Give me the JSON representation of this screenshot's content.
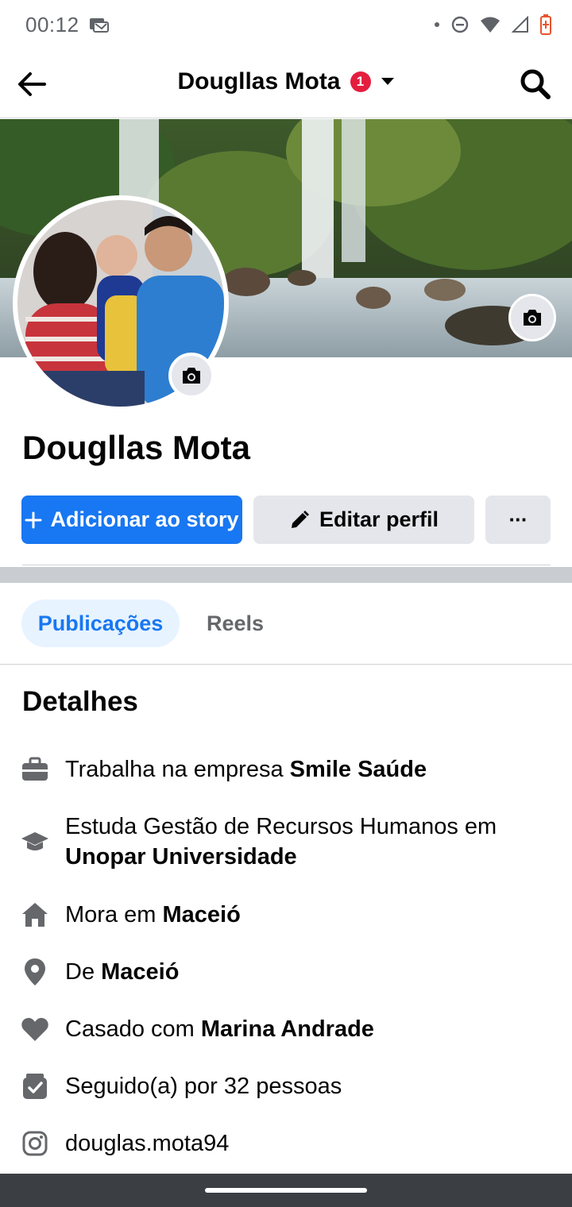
{
  "status_bar": {
    "time": "00:12"
  },
  "header": {
    "title": "Dougllas Mota",
    "badge": "1"
  },
  "profile": {
    "name": "Dougllas Mota"
  },
  "actions": {
    "add_story": "Adicionar ao story",
    "edit_profile": "Editar perfil",
    "more": "···"
  },
  "tabs": [
    {
      "label": "Publicações",
      "active": true
    },
    {
      "label": "Reels",
      "active": false
    }
  ],
  "details": {
    "title": "Detalhes",
    "items": [
      {
        "icon": "briefcase-icon",
        "prefix": "Trabalha na empresa ",
        "bold": "Smile Saúde"
      },
      {
        "icon": "graduation-cap-icon",
        "prefix": "Estuda Gestão de Recursos Humanos em ",
        "bold": "Unopar Universidade"
      },
      {
        "icon": "home-icon",
        "prefix": "Mora em ",
        "bold": "Maceió"
      },
      {
        "icon": "location-pin-icon",
        "prefix": "De ",
        "bold": "Maceió"
      },
      {
        "icon": "heart-icon",
        "prefix": "Casado com ",
        "bold": "Marina Andrade"
      },
      {
        "icon": "followers-icon",
        "prefix": "Seguido(a) por 32 pessoas",
        "bold": ""
      },
      {
        "icon": "instagram-icon",
        "prefix": "douglas.mota94",
        "bold": ""
      }
    ]
  },
  "colors": {
    "accent": "#1877f2",
    "badge": "#e41e3f"
  }
}
